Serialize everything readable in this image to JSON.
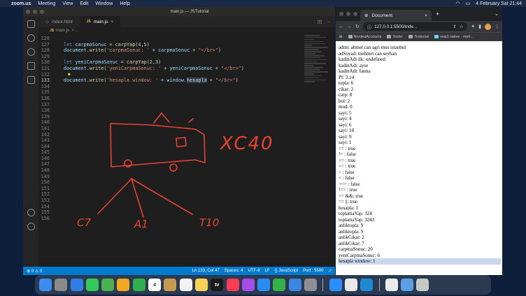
{
  "menubar": {
    "app": "zoom.us",
    "items": [
      "Meeting",
      "View",
      "Edit",
      "Window",
      "Help"
    ],
    "center_title": "main.js — JSTutorial",
    "datetime": "4 February Sat  21:44"
  },
  "vscode": {
    "title": "main.js — JSTutorial",
    "tabs": [
      {
        "icon": "html-icon",
        "label": "index.html",
        "active": false
      },
      {
        "icon": "js",
        "label": "main.js",
        "active": true
      }
    ],
    "breadcrumb": [
      "JS",
      "main.js",
      "> ..."
    ],
    "lines": [
      {
        "n": "126",
        "code": ""
      },
      {
        "n": "127",
        "code": "let carpmaSonuc = carpYap(4,5)"
      },
      {
        "n": "128",
        "code": "document.write('carpmaSonuc: ' + carpmaSonuc + \"</br>\")"
      },
      {
        "n": "129",
        "code": ""
      },
      {
        "n": "130",
        "code": "let yeniCarpmaSonuc = carpYap(2,3)"
      },
      {
        "n": "131",
        "code": "document.write('yeniCarpmaSonuc: ' + yeniCarpmaSonuc + \"</br>\")"
      },
      {
        "n": "132",
        "code": ""
      },
      {
        "n": "133",
        "code": "document.write('hesapla window: ' + window.hesapla + \"</br>\")"
      },
      {
        "n": "134",
        "code": ""
      },
      {
        "n": "135",
        "code": ""
      },
      {
        "n": "136",
        "code": ""
      },
      {
        "n": "137",
        "code": ""
      },
      {
        "n": "138",
        "code": ""
      },
      {
        "n": "139",
        "code": ""
      },
      {
        "n": "140",
        "code": ""
      },
      {
        "n": "141",
        "code": ""
      },
      {
        "n": "142",
        "code": ""
      },
      {
        "n": "143",
        "code": ""
      },
      {
        "n": "144",
        "code": ""
      },
      {
        "n": "145",
        "code": ""
      },
      {
        "n": "146",
        "code": ""
      },
      {
        "n": "147",
        "code": ""
      },
      {
        "n": "148",
        "code": ""
      },
      {
        "n": "149",
        "code": ""
      },
      {
        "n": "150",
        "code": ""
      },
      {
        "n": "151",
        "code": ""
      },
      {
        "n": "152",
        "code": ""
      },
      {
        "n": "153",
        "code": ""
      },
      {
        "n": "154",
        "code": ""
      },
      {
        "n": "155",
        "code": ""
      },
      {
        "n": "156",
        "code": ""
      }
    ],
    "drawing_labels": {
      "car": "XC40",
      "left": "C7",
      "middle": "A1",
      "right": "T10"
    },
    "status": {
      "errors": "0",
      "warnings": "0",
      "position": "Ln 133, Col 47",
      "spaces": "Spaces: 4",
      "encoding": "UTF-8",
      "eol": "LF",
      "language": "{} JavaScript",
      "port": "Port : 5500"
    }
  },
  "browser": {
    "tab_title": "Document",
    "url": "127.0.0.1:5500/inde...",
    "bookmarks": [
      "NordeaAccounts",
      "Tester",
      "Testerisk",
      "react native - meh..."
    ],
    "output_lines": [
      "adim: ahmet can agri mus istanbul",
      "adSoyad: mehmet can seyhan",
      "kadinAdi ilk: undefined",
      "kadinAdi: ayse",
      "kadinAdi: fatma",
      "PI: 3.14",
      "topla: 6",
      "cikar: 2",
      "carp: 8",
      "bol: 2",
      "mod: 0",
      "sayi: 5",
      "sayi: 4",
      "sayi: 6",
      "sayi: 18",
      "sayi: 9",
      "sayi: 1",
      "== : true",
      "!= : false",
      ">= : true",
      "<= : true",
      "> : false",
      "< : false",
      "=== : false",
      "!== : true",
      "== &&: true",
      "== ||: true",
      "hesapla: 1",
      "toplamaYap: 324",
      "toplamaYap: 3243",
      "anliktopla: 9",
      "anliktopla: 9",
      "anlikCikar: 2",
      "anlikCikar: 7",
      "carpmaSonuc: 20",
      "yeniCarpmaSonuc: 6",
      "hesapla window: 1"
    ]
  },
  "dock": {
    "apps": [
      {
        "name": "finder",
        "color": "#3b8df0"
      },
      {
        "name": "launchpad",
        "color": "#8a8a8a"
      },
      {
        "name": "safari",
        "color": "#2f7ee6"
      },
      {
        "name": "messages",
        "color": "#34c759"
      },
      {
        "name": "maps",
        "color": "#4caf50"
      },
      {
        "name": "photos",
        "color": "#f5a623"
      },
      {
        "name": "facetime",
        "color": "#30b050"
      },
      {
        "name": "calendar",
        "color": "#ffffff",
        "label": "4"
      },
      {
        "name": "notes-brown",
        "color": "#c79a52"
      },
      {
        "name": "reminders",
        "color": "#f2f2f2"
      },
      {
        "name": "notes",
        "color": "#f7d154"
      },
      {
        "name": "tv",
        "color": "#1a1a1a",
        "label": "tv"
      },
      {
        "name": "music",
        "color": "#fb3c52"
      },
      {
        "name": "podcasts",
        "color": "#a64de8"
      },
      {
        "name": "appstore-alt",
        "color": "#2a8cf0"
      },
      {
        "name": "numbers",
        "color": "#33b249"
      },
      {
        "name": "keynote",
        "color": "#3a86e0"
      },
      {
        "name": "settings",
        "color": "#8e8e93"
      },
      {
        "name": "zoom",
        "color": "#2d8cff"
      },
      {
        "name": "chrome",
        "color": "#e8e8e8"
      },
      {
        "name": "vscode",
        "color": "#1f8ad2"
      },
      {
        "name": "preview",
        "color": "#ececec"
      },
      {
        "name": "downloads",
        "color": "#5aa0e6"
      },
      {
        "name": "trash",
        "color": "#c8c8c8"
      }
    ]
  }
}
